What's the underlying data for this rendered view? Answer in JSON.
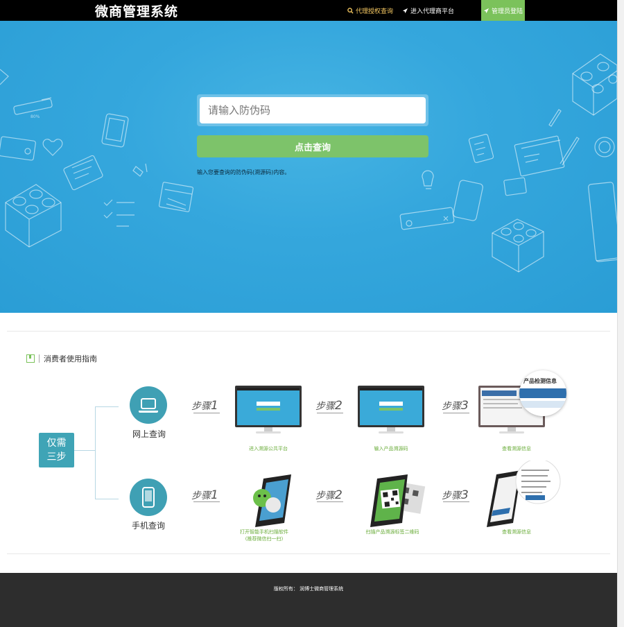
{
  "header": {
    "logo": "微商管理系统",
    "nav_agent": "代理授权查询",
    "nav_platform": "进入代理商平台",
    "nav_admin": "管理员登陆"
  },
  "hero": {
    "search_placeholder": "请输入防伪码",
    "query_button": "点击查询",
    "hint": "输入您要查询的防伪码(溯源码)内容。"
  },
  "guide": {
    "title": "消费者使用指南",
    "only_three": [
      "仅需",
      "三步"
    ],
    "online": {
      "label": "网上查询",
      "steps": [
        {
          "step": "步骤",
          "num": "1",
          "caption": "进入溯源公共平台"
        },
        {
          "step": "步骤",
          "num": "2",
          "caption": "输入产品溯源码"
        },
        {
          "step": "步骤",
          "num": "3",
          "caption": "查看溯源信息"
        }
      ],
      "panel_title": "产品检测信息"
    },
    "mobile": {
      "label": "手机查询",
      "steps": [
        {
          "step": "步骤",
          "num": "1",
          "caption_lines": [
            "打开智能手机扫描软件",
            "(推荐微信扫一扫)"
          ]
        },
        {
          "step": "步骤",
          "num": "2",
          "caption": "扫描产品溯源标签二维码"
        },
        {
          "step": "步骤",
          "num": "3",
          "caption": "查看溯源信息"
        }
      ]
    }
  },
  "footer": {
    "copyright": "版权所有： 润博士微商管理系统"
  },
  "colors": {
    "hero_blue": "#2a9dd5",
    "green": "#7bc25b",
    "teal": "#3fa0b4",
    "footer": "#2d2d2d"
  }
}
